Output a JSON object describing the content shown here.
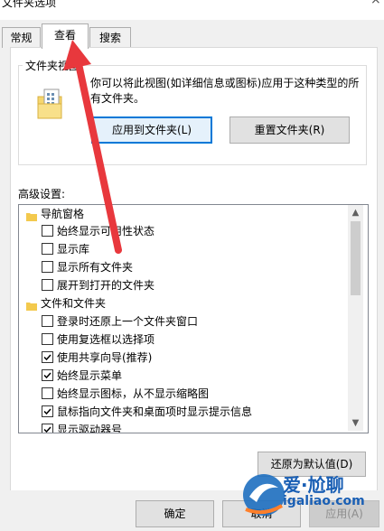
{
  "window": {
    "title": "文件夹选项",
    "close_glyph": "×"
  },
  "tabs": [
    {
      "label": "常规",
      "active": false
    },
    {
      "label": "查看",
      "active": true
    },
    {
      "label": "搜索",
      "active": false
    }
  ],
  "folder_views": {
    "group_label": "文件夹视图",
    "description": "你可以将此视图(如详细信息或图标)应用于这种类型的所有文件夹。",
    "apply_button": "应用到文件夹(L)",
    "reset_button": "重置文件夹(R)"
  },
  "advanced": {
    "label": "高级设置:",
    "items": [
      {
        "type": "category",
        "label": "导航窗格"
      },
      {
        "type": "option",
        "label": "始终显示可用性状态",
        "checked": false
      },
      {
        "type": "option",
        "label": "显示库",
        "checked": false
      },
      {
        "type": "option",
        "label": "显示所有文件夹",
        "checked": false
      },
      {
        "type": "option",
        "label": "展开到打开的文件夹",
        "checked": false
      },
      {
        "type": "category",
        "label": "文件和文件夹"
      },
      {
        "type": "option",
        "label": "登录时还原上一个文件夹窗口",
        "checked": false
      },
      {
        "type": "option",
        "label": "使用复选框以选择项",
        "checked": false
      },
      {
        "type": "option",
        "label": "使用共享向导(推荐)",
        "checked": true
      },
      {
        "type": "option",
        "label": "始终显示菜单",
        "checked": true
      },
      {
        "type": "option",
        "label": "始终显示图标，从不显示缩略图",
        "checked": false
      },
      {
        "type": "option",
        "label": "鼠标指向文件夹和桌面项时显示提示信息",
        "checked": true
      },
      {
        "type": "option",
        "label": "显示驱动器号",
        "checked": true
      }
    ],
    "restore_button": "还原为默认值(D)"
  },
  "dialog_buttons": {
    "ok": "确定",
    "cancel": "取消",
    "apply": "应用(A)"
  },
  "watermark": {
    "brand": "爱·尬聊",
    "url": "igaliao.com"
  },
  "colors": {
    "accent": "#0078d7",
    "annotation_arrow": "#e8383d",
    "watermark": "#1a5fb4"
  }
}
